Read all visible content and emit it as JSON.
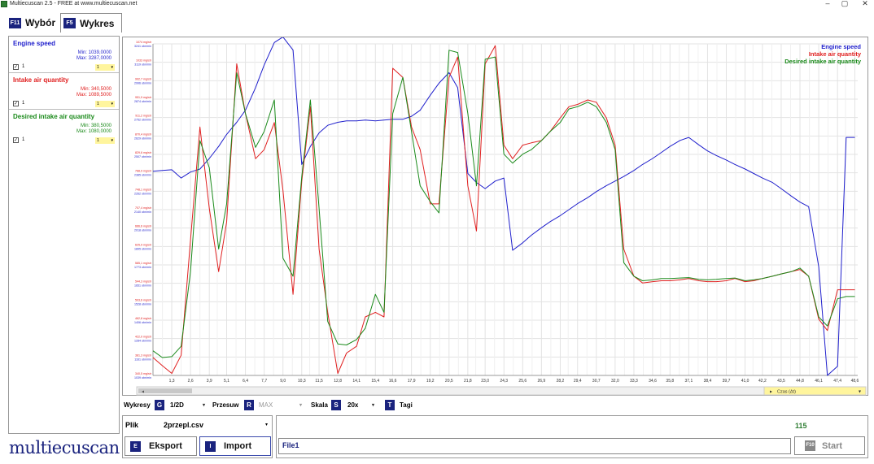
{
  "window": {
    "title": "Multiecuscan 2.5 - FREE at www.multiecuscan.net",
    "minimize": "–",
    "maximize": "▢",
    "close": "✕"
  },
  "tabs": [
    {
      "key": "F11",
      "label": "Wybór"
    },
    {
      "key": "F5",
      "label": "Wykres"
    }
  ],
  "signals": [
    {
      "name": "Engine speed",
      "min": "Min: 1039,0000",
      "max": "Max: 3287,0000",
      "checked": "✓",
      "check_label": "1",
      "select": "1",
      "select_arrow": "▾",
      "color": "#1f1fcc"
    },
    {
      "name": "Intake air quantity",
      "min": "Min: 340,5000",
      "max": "Max: 1089,5000",
      "checked": "✓",
      "check_label": "1",
      "select": "1",
      "select_arrow": "▾",
      "color": "#e02020"
    },
    {
      "name": "Desired intake air quantity",
      "min": "Min: 380,5000",
      "max": "Max: 1080,0000",
      "checked": "✓",
      "check_label": "1",
      "select": "1",
      "select_arrow": "▾",
      "color": "#1a8a1a"
    }
  ],
  "chart_data": {
    "type": "line",
    "xlabel": "Czas (Δt)",
    "x": [
      0.0,
      0.65,
      1.3,
      1.95,
      2.6,
      3.25,
      3.9,
      4.55,
      5.1,
      5.8,
      6.4,
      7.1,
      7.7,
      8.4,
      9.0,
      9.7,
      10.3,
      10.9,
      11.5,
      12.1,
      12.8,
      13.4,
      14.1,
      14.7,
      15.4,
      16.0,
      16.6,
      17.3,
      17.9,
      18.5,
      19.2,
      19.8,
      20.5,
      21.1,
      21.8,
      22.4,
      23.0,
      23.7,
      24.3,
      24.9,
      25.6,
      26.2,
      26.9,
      27.5,
      28.2,
      28.8,
      29.4,
      30.1,
      30.7,
      31.4,
      32.0,
      32.6,
      33.3,
      33.9,
      34.6,
      35.2,
      35.8,
      36.5,
      37.1,
      37.8,
      38.4,
      39.0,
      39.7,
      40.3,
      41.0,
      41.6,
      42.2,
      42.9,
      43.5,
      44.2,
      44.8,
      45.4,
      46.1,
      46.7,
      47.4,
      48.0,
      48.6
    ],
    "x_ticks": [
      "1,3",
      "2,6",
      "3,9",
      "5,1",
      "6,4",
      "7,7",
      "9,0",
      "10,3",
      "11,5",
      "12,8",
      "14,1",
      "15,4",
      "16,6",
      "17,9",
      "19,2",
      "20,5",
      "21,8",
      "23,0",
      "24,3",
      "25,6",
      "26,9",
      "28,2",
      "29,4",
      "30,7",
      "32,0",
      "33,3",
      "34,6",
      "35,8",
      "37,1",
      "38,4",
      "39,7",
      "41,0",
      "42,2",
      "43,5",
      "44,8",
      "46,1",
      "47,4",
      "48,6"
    ],
    "y_tick_labels_air": [
      "1074 mg/str",
      "1033 mg/str",
      "992,7 mg/str",
      "951,9 mg/str",
      "911,2 mg/str",
      "870,4 mg/str",
      "829,6 mg/str",
      "788,9 mg/str",
      "748,1 mg/str",
      "707,4 mg/str",
      "666,6 mg/str",
      "625,9 mg/str",
      "585,1 mg/str",
      "544,3 mg/str",
      "503,6 mg/str",
      "462,8 mg/str",
      "422,0 mg/str",
      "381,3 mg/str",
      "340,5 mg/str"
    ],
    "y_tick_labels_rpm": [
      "3241 obr/min",
      "3119 obr/min",
      "2996 obr/min",
      "2874 obr/min",
      "2752 obr/min",
      "2629 obr/min",
      "2507 obr/min",
      "2385 obr/min",
      "2262 obr/min",
      "2140 obr/min",
      "2018 obr/min",
      "1895 obr/min",
      "1773 obr/min",
      "1651 obr/min",
      "1528 obr/min",
      "1406 obr/min",
      "1284 obr/min",
      "1161 obr/min",
      "1039 obr/min"
    ],
    "ylim_air": [
      340.5,
      1074
    ],
    "ylim_rpm": [
      1039,
      3241
    ],
    "series": [
      {
        "name": "Engine speed",
        "color": "#1f1fcc",
        "axis": "rpm",
        "values": [
          2395,
          2400,
          2405,
          2350,
          2390,
          2410,
          2480,
          2560,
          2640,
          2720,
          2800,
          2950,
          3100,
          3250,
          3287,
          3200,
          2440,
          2560,
          2650,
          2700,
          2720,
          2730,
          2730,
          2735,
          2730,
          2735,
          2740,
          2740,
          2760,
          2800,
          2900,
          2980,
          3050,
          2950,
          2380,
          2320,
          2280,
          2330,
          2350,
          1870,
          1920,
          1970,
          2020,
          2060,
          2100,
          2140,
          2180,
          2220,
          2260,
          2300,
          2330,
          2360,
          2400,
          2440,
          2480,
          2520,
          2560,
          2600,
          2620,
          2570,
          2530,
          2500,
          2470,
          2440,
          2410,
          2380,
          2350,
          2320,
          2280,
          2230,
          2190,
          2160,
          1760,
          1039,
          1100,
          2620,
          2620
        ]
      },
      {
        "name": "Intake air quantity",
        "color": "#e02020",
        "axis": "air",
        "values": [
          380,
          362,
          345,
          385,
          640,
          890,
          710,
          570,
          680,
          1030,
          920,
          820,
          840,
          900,
          750,
          520,
          770,
          935,
          620,
          480,
          345,
          390,
          405,
          470,
          480,
          470,
          1020,
          1000,
          890,
          840,
          720,
          720,
          1000,
          1045,
          760,
          660,
          1030,
          1070,
          850,
          820,
          850,
          855,
          860,
          880,
          910,
          935,
          940,
          950,
          945,
          910,
          850,
          620,
          560,
          545,
          548,
          550,
          550,
          552,
          555,
          550,
          548,
          548,
          550,
          555,
          548,
          550,
          555,
          560,
          565,
          570,
          575,
          560,
          465,
          440,
          530,
          530,
          530
        ]
      },
      {
        "name": "Desired intake air quantity",
        "color": "#1a8a1a",
        "axis": "air",
        "values": [
          395,
          380,
          382,
          405,
          570,
          860,
          800,
          620,
          720,
          1010,
          920,
          845,
          880,
          950,
          600,
          560,
          780,
          950,
          710,
          460,
          410,
          408,
          420,
          445,
          520,
          480,
          920,
          1000,
          880,
          760,
          725,
          700,
          1060,
          1055,
          920,
          760,
          1040,
          1045,
          830,
          810,
          830,
          840,
          860,
          880,
          900,
          930,
          935,
          945,
          935,
          900,
          840,
          590,
          560,
          550,
          552,
          555,
          555,
          556,
          557,
          553,
          552,
          553,
          555,
          556,
          550,
          552,
          555,
          560,
          565,
          570,
          578,
          560,
          470,
          450,
          510,
          515,
          515
        ]
      }
    ],
    "legend": "top-right"
  },
  "toolbar": {
    "wykresy_label": "Wykresy",
    "wykresy_key": "G",
    "wykresy_value": "1/2D",
    "przesuw_label": "Przesuw",
    "przesuw_key": "R",
    "przesuw_value": "MAX",
    "skala_label": "Skala",
    "skala_key": "S",
    "skala_value": "20x",
    "tagi_key": "T",
    "tagi_label": "Tagi",
    "arrow": "▾"
  },
  "file": {
    "label": "Plik",
    "name": "2przepl.csv",
    "arrow": "▾"
  },
  "buttons": {
    "export_key": "E",
    "export_label": "Eksport",
    "import_key": "I",
    "import_label": "Import",
    "start_key": "F10",
    "start_label": "Start"
  },
  "status": {
    "counter": "115",
    "field_text": "File1"
  },
  "logo": "multiecuscan"
}
